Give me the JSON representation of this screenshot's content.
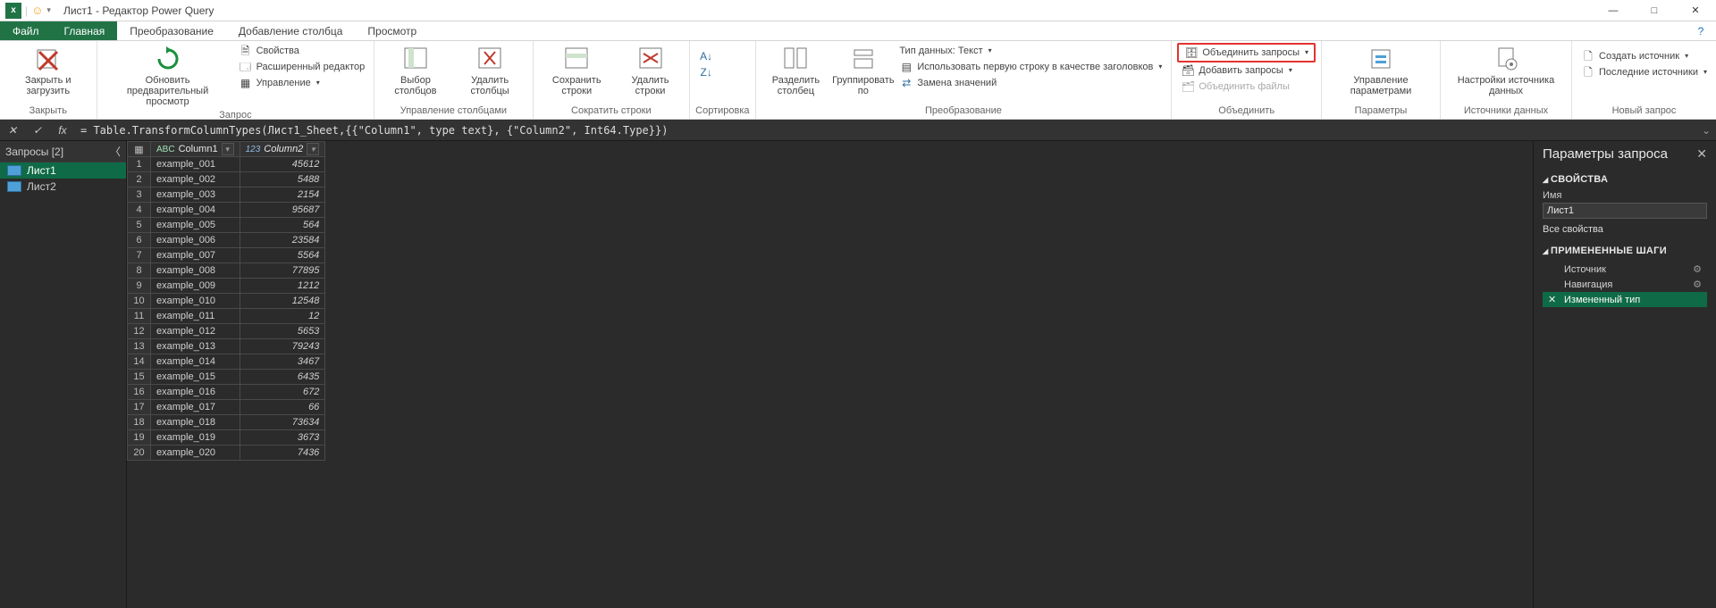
{
  "titlebar": {
    "title": "Лист1 - Редактор Power Query"
  },
  "winbtns": {
    "min": "—",
    "max": "□",
    "close": "✕"
  },
  "tabs": {
    "file": "Файл",
    "home": "Главная",
    "transform": "Преобразование",
    "addcol": "Добавление столбца",
    "view": "Просмотр"
  },
  "ribbon": {
    "closeLoad": "Закрыть и\nзагрузить",
    "closeGroup": "Закрыть",
    "refresh": "Обновить предварительный\nпросмотр",
    "props": "Свойства",
    "advEditor": "Расширенный редактор",
    "manage": "Управление",
    "queryGroup": "Запрос",
    "chooseCols": "Выбор\nстолбцов",
    "removeCols": "Удалить\nстолбцы",
    "manageColsGroup": "Управление столбцами",
    "keepRows": "Сохранить\nстроки",
    "removeRows": "Удалить\nстроки",
    "reduceRowsGroup": "Сократить строки",
    "sortGroup": "Сортировка",
    "split": "Разделить\nстолбец",
    "groupBy": "Группировать\nпо",
    "dataType": "Тип данных: Текст",
    "useFirstRow": "Использовать первую строку в качестве заголовков",
    "replace": "Замена значений",
    "transformGroup": "Преобразование",
    "mergeQ": "Объединить запросы",
    "appendQ": "Добавить запросы",
    "combineFiles": "Объединить файлы",
    "combineGroup": "Объединить",
    "manageParams": "Управление\nпараметрами",
    "paramsGroup": "Параметры",
    "dsSettings": "Настройки\nисточника данных",
    "dsGroup": "Источники данных",
    "newSource": "Создать источник",
    "recentSources": "Последние источники",
    "newQueryGroup": "Новый запрос"
  },
  "formula": "= Table.TransformColumnTypes(Лист1_Sheet,{{\"Column1\", type text}, {\"Column2\", Int64.Type}})",
  "queries": {
    "header": "Запросы [2]",
    "items": [
      "Лист1",
      "Лист2"
    ]
  },
  "grid": {
    "col1": {
      "type": "ABC",
      "name": "Column1"
    },
    "col2": {
      "type": "123",
      "name": "Column2"
    },
    "rows": [
      {
        "c1": "example_001",
        "c2": "45612"
      },
      {
        "c1": "example_002",
        "c2": "5488"
      },
      {
        "c1": "example_003",
        "c2": "2154"
      },
      {
        "c1": "example_004",
        "c2": "95687"
      },
      {
        "c1": "example_005",
        "c2": "564"
      },
      {
        "c1": "example_006",
        "c2": "23584"
      },
      {
        "c1": "example_007",
        "c2": "5564"
      },
      {
        "c1": "example_008",
        "c2": "77895"
      },
      {
        "c1": "example_009",
        "c2": "1212"
      },
      {
        "c1": "example_010",
        "c2": "12548"
      },
      {
        "c1": "example_011",
        "c2": "12"
      },
      {
        "c1": "example_012",
        "c2": "5653"
      },
      {
        "c1": "example_013",
        "c2": "79243"
      },
      {
        "c1": "example_014",
        "c2": "3467"
      },
      {
        "c1": "example_015",
        "c2": "6435"
      },
      {
        "c1": "example_016",
        "c2": "672"
      },
      {
        "c1": "example_017",
        "c2": "66"
      },
      {
        "c1": "example_018",
        "c2": "73634"
      },
      {
        "c1": "example_019",
        "c2": "3673"
      },
      {
        "c1": "example_020",
        "c2": "7436"
      }
    ]
  },
  "panel": {
    "title": "Параметры запроса",
    "propsHead": "СВОЙСТВА",
    "nameLabel": "Имя",
    "nameValue": "Лист1",
    "allProps": "Все свойства",
    "stepsHead": "ПРИМЕНЕННЫЕ ШАГИ",
    "steps": [
      {
        "name": "Источник",
        "gear": true
      },
      {
        "name": "Навигация",
        "gear": true
      },
      {
        "name": "Измененный тип",
        "gear": false,
        "selected": true
      }
    ]
  }
}
